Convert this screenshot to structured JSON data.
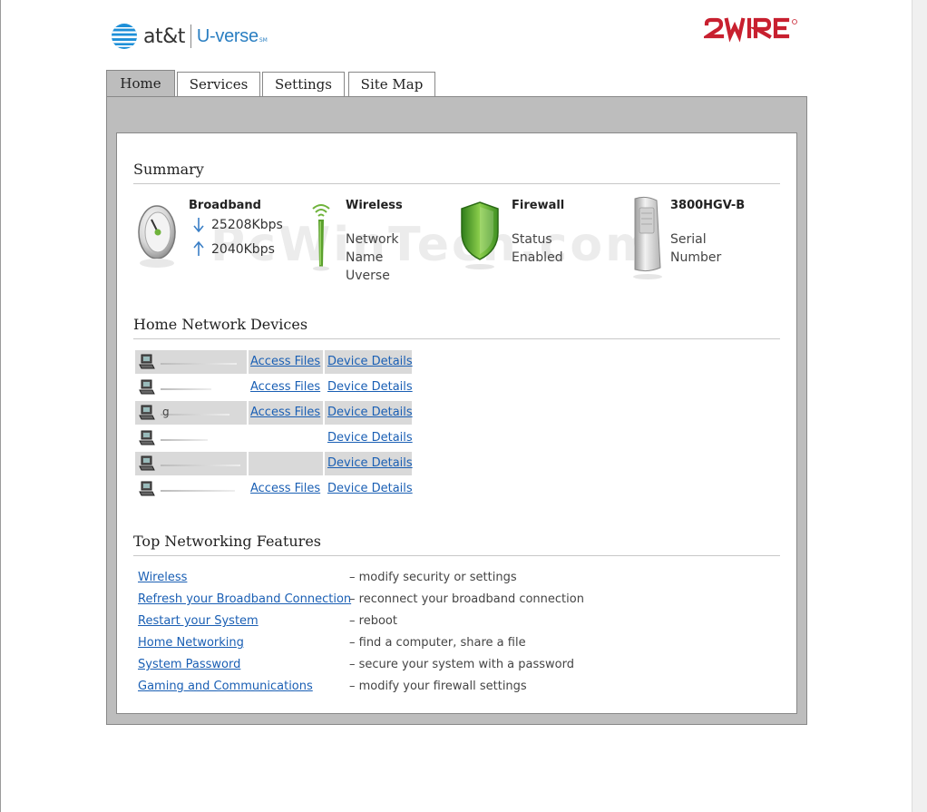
{
  "header": {
    "att_text": "at&t",
    "uverse_text": "U-verse",
    "uverse_tm": "SM",
    "brand_2wire": "2WIRE"
  },
  "tabs": [
    {
      "label": "Home",
      "active": true
    },
    {
      "label": "Services",
      "active": false
    },
    {
      "label": "Settings",
      "active": false
    },
    {
      "label": "Site Map",
      "active": false
    }
  ],
  "summary": {
    "title": "Summary",
    "broadband": {
      "label": "Broadband",
      "down": "25208Kbps",
      "up": "2040Kbps"
    },
    "wireless": {
      "label": "Wireless",
      "line1": "Network",
      "line2": "Name",
      "line3": "Uverse"
    },
    "firewall": {
      "label": "Firewall",
      "line1": "Status",
      "line2": "Enabled"
    },
    "device": {
      "label": "3800HGV-B",
      "line1": "Serial",
      "line2": "Number"
    }
  },
  "watermark": "PcWinTech.com",
  "devices": {
    "title": "Home Network Devices",
    "access_label": "Access Files",
    "details_label": "Device Details",
    "rows": [
      {
        "shaded": true,
        "access": true
      },
      {
        "shaded": false,
        "access": true
      },
      {
        "shaded": true,
        "access": true,
        "name_text": "g"
      },
      {
        "shaded": false,
        "access": false
      },
      {
        "shaded": true,
        "access": false
      },
      {
        "shaded": false,
        "access": true
      }
    ]
  },
  "features": {
    "title": "Top Networking Features",
    "items": [
      {
        "link": "Wireless",
        "desc": "– modify security or settings"
      },
      {
        "link": "Refresh your Broadband Connection",
        "desc": "– reconnect your broadband connection"
      },
      {
        "link": "Restart your System",
        "desc": "– reboot"
      },
      {
        "link": "Home Networking",
        "desc": "– find a computer, share a file"
      },
      {
        "link": "System Password",
        "desc": "– secure your system with a password"
      },
      {
        "link": "Gaming and Communications",
        "desc": "– modify your firewall settings"
      }
    ]
  },
  "colors": {
    "link": "#1a5fb4",
    "panel": "#bdbdbd",
    "brand_red": "#c8202f",
    "uverse_blue": "#2b7fc2"
  }
}
